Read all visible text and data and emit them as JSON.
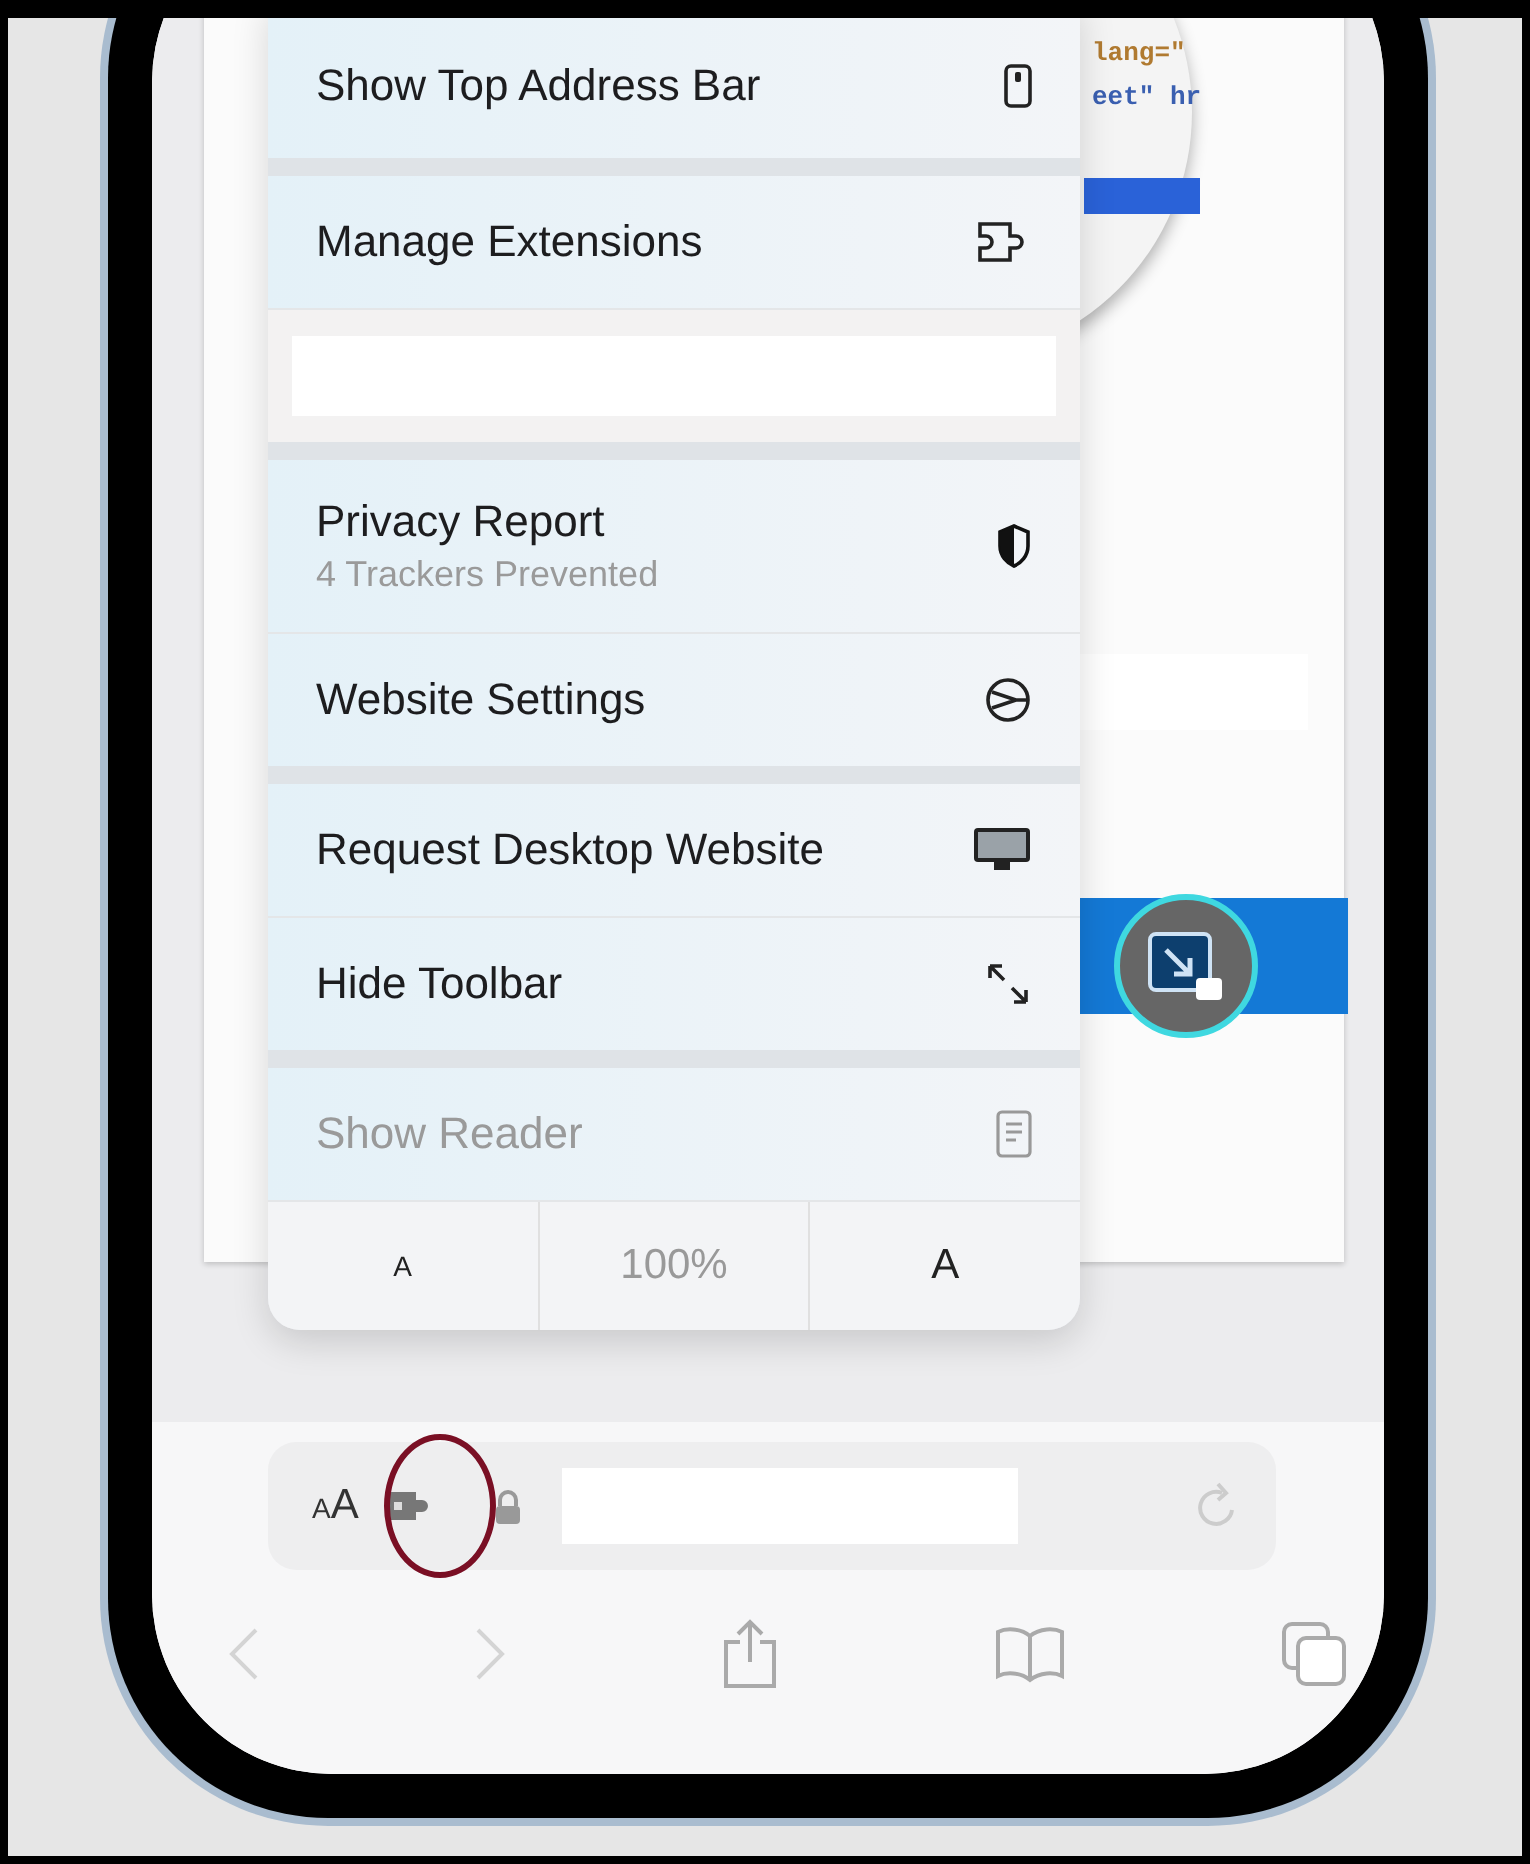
{
  "menu": {
    "sections": [
      {
        "items": [
          {
            "kind": "item",
            "label": "Show Top Address Bar",
            "disabled": false
          }
        ]
      },
      {
        "items": [
          {
            "kind": "item",
            "label": "Manage Extensions",
            "disabled": false
          },
          {
            "kind": "blank"
          }
        ]
      },
      {
        "items": [
          {
            "kind": "item",
            "label": "Privacy Report",
            "subtitle": "4 Trackers Prevented",
            "disabled": false
          },
          {
            "kind": "item",
            "label": "Website Settings",
            "disabled": false
          }
        ]
      },
      {
        "items": [
          {
            "kind": "item",
            "label": "Request Desktop Website",
            "disabled": false
          },
          {
            "kind": "item",
            "label": "Hide Toolbar",
            "disabled": false
          }
        ]
      },
      {
        "items": [
          {
            "kind": "item",
            "label": "Show Reader",
            "disabled": true
          },
          {
            "kind": "zoom",
            "smaller": "A",
            "zoom": "100%",
            "larger": "A"
          }
        ]
      }
    ]
  },
  "magnifier": {
    "code_lines": [
      "lang=\"",
      "eet\" hr"
    ]
  },
  "address_bar": {
    "format_small": "A",
    "format_large": "A"
  },
  "toolbar": {
    "back_disabled": true,
    "forward_disabled": true
  }
}
